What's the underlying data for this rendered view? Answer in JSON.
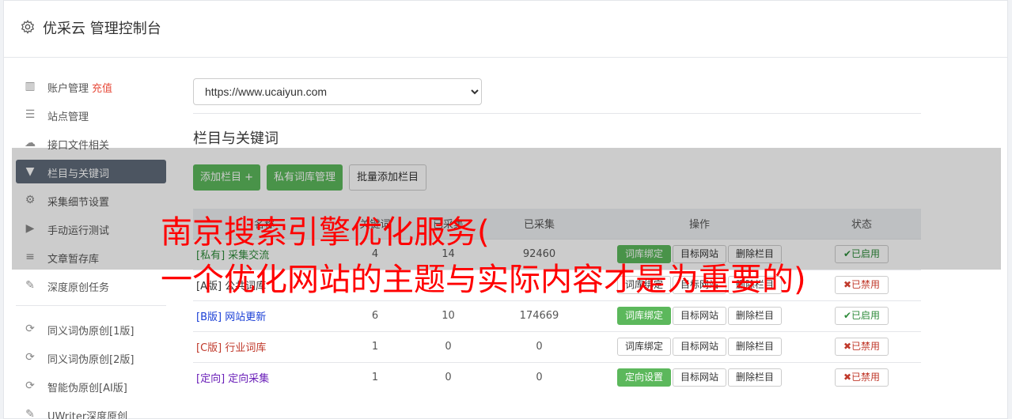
{
  "header": {
    "title": "优采云 管理控制台",
    "icon": "gear-icon"
  },
  "sidebar": {
    "items": [
      {
        "label": "账户管理",
        "extra": "充值",
        "icon": "bar-chart-icon",
        "active": false
      },
      {
        "label": "站点管理",
        "icon": "server-icon",
        "active": false
      },
      {
        "label": "接口文件相关",
        "icon": "cloud-upload-icon",
        "active": false
      },
      {
        "label": "栏目与关键词",
        "icon": "filter-icon",
        "active": true
      },
      {
        "label": "采集细节设置",
        "icon": "cogs-icon",
        "active": false
      },
      {
        "label": "手动运行测试",
        "icon": "play-icon",
        "active": false
      },
      {
        "label": "文章暂存库",
        "icon": "database-icon",
        "active": false
      },
      {
        "label": "深度原创任务",
        "icon": "edit-icon",
        "active": false
      }
    ],
    "items2": [
      {
        "label": "同义词伪原创[1版]",
        "icon": "refresh-icon"
      },
      {
        "label": "同义词伪原创[2版]",
        "icon": "refresh-icon"
      },
      {
        "label": "智能伪原创[AI版]",
        "icon": "refresh-icon"
      },
      {
        "label": "UWriter深度原创",
        "icon": "edit-icon"
      }
    ]
  },
  "main": {
    "site_select": "https://www.ucaiyun.com",
    "section_title": "栏目与关键词",
    "buttons": {
      "add": "添加栏目 +",
      "private": "私有词库管理",
      "batch": "批量添加栏目"
    },
    "table": {
      "headers": [
        "名称",
        "关键词",
        "已采集",
        "已采集",
        "操作",
        "状态"
      ],
      "rows": [
        {
          "name": "[私有] 采集交流",
          "kw": "4",
          "kw2": "14",
          "count": "92460",
          "op1": "词库绑定",
          "op1_active": true,
          "op2": "目标网站",
          "op3": "删除栏目",
          "status": "已启用",
          "status_on": true
        },
        {
          "name": "[A版] 公共词库",
          "kw": "",
          "kw2": "",
          "count": "",
          "op1": "词库绑定",
          "op1_active": false,
          "op2": "目标网站",
          "op3": "删除栏目",
          "status": "已禁用",
          "status_on": false
        },
        {
          "name": "[B版] 网站更新",
          "kw": "6",
          "kw2": "10",
          "count": "174669",
          "op1": "词库绑定",
          "op1_active": true,
          "op2": "目标网站",
          "op3": "删除栏目",
          "status": "已启用",
          "status_on": true
        },
        {
          "name": "[C版] 行业词库",
          "kw": "1",
          "kw2": "0",
          "count": "0",
          "op1": "词库绑定",
          "op1_active": false,
          "op2": "目标网站",
          "op3": "删除栏目",
          "status": "已禁用",
          "status_on": false
        },
        {
          "name": "[定向] 定向采集",
          "kw": "1",
          "kw2": "0",
          "count": "0",
          "op1": "定向设置",
          "op1_active": true,
          "op2": "目标网站",
          "op3": "删除栏目",
          "status": "已禁用",
          "status_on": false
        }
      ]
    }
  },
  "overlay_text": {
    "line1": "南京搜索引擎优化服务(",
    "line2": "一个优化网站的主题与实际内容才是为重要的)"
  },
  "colors": {
    "accent_green": "#5cb85c",
    "nav_active": "#5f6b7a",
    "overlay_red": "#ff0000"
  }
}
